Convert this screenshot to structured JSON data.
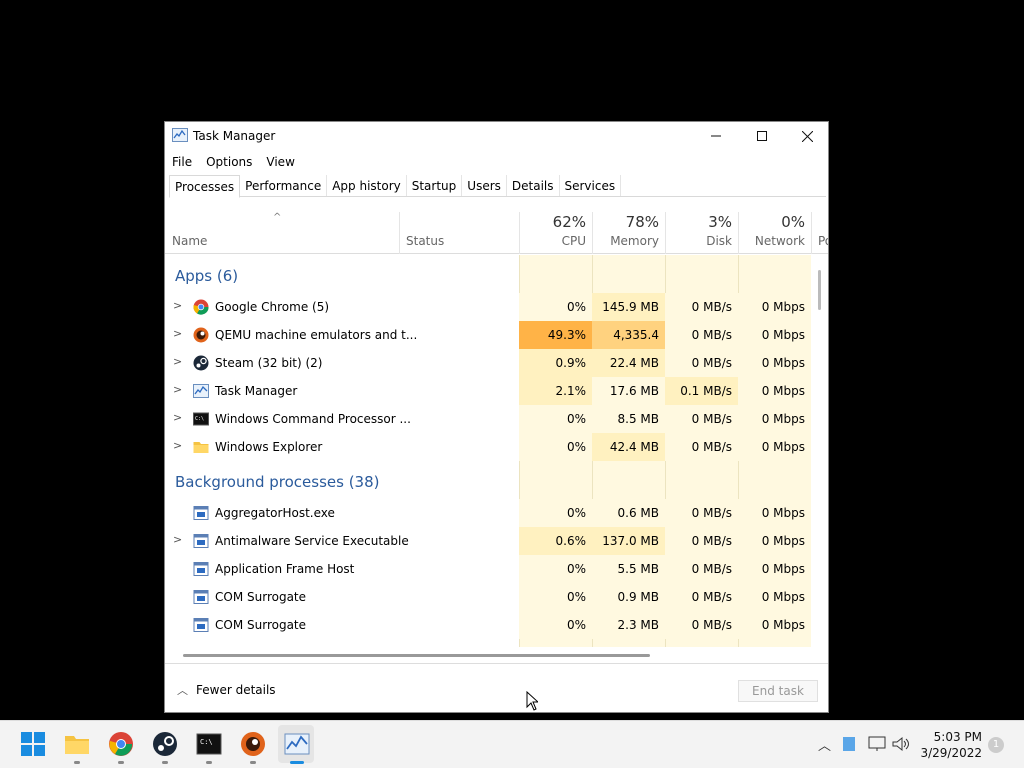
{
  "window": {
    "title": "Task Manager",
    "min_label": "—",
    "max_label": "☐",
    "close_label": "✕"
  },
  "menu": [
    "File",
    "Options",
    "View"
  ],
  "tabs": [
    "Processes",
    "Performance",
    "App history",
    "Startup",
    "Users",
    "Details",
    "Services"
  ],
  "header": {
    "name": "Name",
    "status": "Status",
    "cpu_pct": "62%",
    "cpu": "CPU",
    "mem_pct": "78%",
    "mem": "Memory",
    "disk_pct": "3%",
    "disk": "Disk",
    "net_pct": "0%",
    "net": "Network",
    "power": "Po"
  },
  "groups": {
    "apps": "Apps (6)",
    "background": "Background processes (38)"
  },
  "apps": [
    {
      "name": "Google Chrome (5)",
      "cpu": "0%",
      "mem": "145.9 MB",
      "disk": "0 MB/s",
      "net": "0 Mbps",
      "icon": "chrome-icon"
    },
    {
      "name": "QEMU machine emulators and t...",
      "cpu": "49.3%",
      "mem": "4,335.4 MB",
      "disk": "0 MB/s",
      "net": "0 Mbps",
      "icon": "qemu-icon"
    },
    {
      "name": "Steam (32 bit) (2)",
      "cpu": "0.9%",
      "mem": "22.4 MB",
      "disk": "0 MB/s",
      "net": "0 Mbps",
      "icon": "steam-icon"
    },
    {
      "name": "Task Manager",
      "cpu": "2.1%",
      "mem": "17.6 MB",
      "disk": "0.1 MB/s",
      "net": "0 Mbps",
      "icon": "task-manager-icon"
    },
    {
      "name": "Windows Command Processor ...",
      "cpu": "0%",
      "mem": "8.5 MB",
      "disk": "0 MB/s",
      "net": "0 Mbps",
      "icon": "cmd-icon"
    },
    {
      "name": "Windows Explorer",
      "cpu": "0%",
      "mem": "42.4 MB",
      "disk": "0 MB/s",
      "net": "0 Mbps",
      "icon": "folder-icon"
    }
  ],
  "background": [
    {
      "name": "AggregatorHost.exe",
      "cpu": "0%",
      "mem": "0.6 MB",
      "disk": "0 MB/s",
      "net": "0 Mbps",
      "expandable": false
    },
    {
      "name": "Antimalware Service Executable",
      "cpu": "0.6%",
      "mem": "137.0 MB",
      "disk": "0 MB/s",
      "net": "0 Mbps",
      "expandable": true
    },
    {
      "name": "Application Frame Host",
      "cpu": "0%",
      "mem": "5.5 MB",
      "disk": "0 MB/s",
      "net": "0 Mbps",
      "expandable": false
    },
    {
      "name": "COM Surrogate",
      "cpu": "0%",
      "mem": "0.9 MB",
      "disk": "0 MB/s",
      "net": "0 Mbps",
      "expandable": false
    },
    {
      "name": "COM Surrogate",
      "cpu": "0%",
      "mem": "2.3 MB",
      "disk": "0 MB/s",
      "net": "0 Mbps",
      "expandable": false
    }
  ],
  "footer": {
    "fewer_details": "Fewer details",
    "end_task": "End task"
  },
  "taskbar": {
    "time": "5:03 PM",
    "date": "3/29/2022",
    "notification_count": "1"
  },
  "colors": {
    "heat_low": "#fff9e0",
    "heat_mid": "#fff1c0",
    "heat_high": "#ffd27f",
    "heat_highest": "#ffb347",
    "group_title": "#2b5b9c"
  }
}
